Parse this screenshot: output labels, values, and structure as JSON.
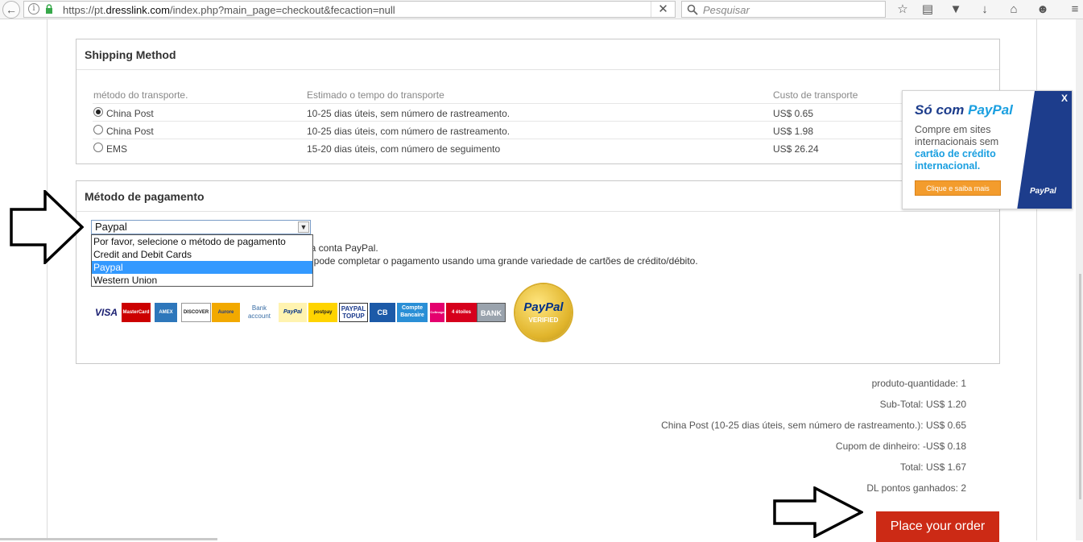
{
  "browser": {
    "url_prefix": "https://pt.",
    "url_domain": "dresslink.com",
    "url_suffix": "/index.php?main_page=checkout&fecaction=null",
    "search_placeholder": "Pesquisar",
    "clear_glyph": "✕",
    "info_glyph": "i"
  },
  "shipping": {
    "title": "Shipping Method",
    "headers": [
      "método do transporte.",
      "Estimado o tempo do transporte",
      "Custo de transporte"
    ],
    "rows": [
      {
        "method": "China Post",
        "time": "10-25 dias úteis, sem número de rastreamento.",
        "cost": "US$ 0.65",
        "selected": true
      },
      {
        "method": "China Post",
        "time": "10-25 dias úteis, com número de rastreamento.",
        "cost": "US$ 1.98",
        "selected": false
      },
      {
        "method": "EMS",
        "time": "15-20 dias úteis, com número de seguimento",
        "cost": "US$ 26.24",
        "selected": false
      }
    ]
  },
  "payment": {
    "title": "Método de pagamento",
    "selected": "Paypal",
    "options": [
      "Por favor, selecione o método de pagamento",
      "Credit and Debit Cards",
      "Paypal",
      "Western Union"
    ],
    "text1": "sua conta PayPal.",
    "text2": "da pode completar o pagamento usando uma grande variedade de cartões de crédito/débito.",
    "cards": [
      "VISA",
      "MasterCard",
      "AMEX",
      "DISCOVER",
      "Aurore",
      "Bank account",
      "PayPal",
      "postpay",
      "PAYPAL TOPUP",
      "CB",
      "Compte Bancaire",
      "Cofinoga",
      "4 étoiles",
      "BANK"
    ],
    "seal_line1": "PayPal",
    "seal_line2": "VERIFIED"
  },
  "summary": {
    "quantity": "produto-quantidade: 1",
    "subtotal": "Sub-Total: US$ 1.20",
    "shipping": "China Post (10-25 dias úteis, sem número de rastreamento.): US$ 0.65",
    "coupon": "Cupom de dinheiro: -US$ 0.18",
    "total": "Total: US$ 1.67",
    "points": "DL pontos ganhados: 2"
  },
  "order_button": "Place your order",
  "ad": {
    "title_a": "Só com ",
    "title_b": "PayPal",
    "text_a": "Compre em sites internacionais sem ",
    "text_b": "cartão de crédito internacional.",
    "button": "Clique e saiba mais",
    "close": "X",
    "logo": "PayPal"
  },
  "colors": {
    "order_button": "#cc2a15",
    "paypal_blue": "#1d3d8c",
    "paypal_light": "#1a9fe0",
    "ad_button": "#f39c2d",
    "select_highlight": "#3399ff"
  }
}
